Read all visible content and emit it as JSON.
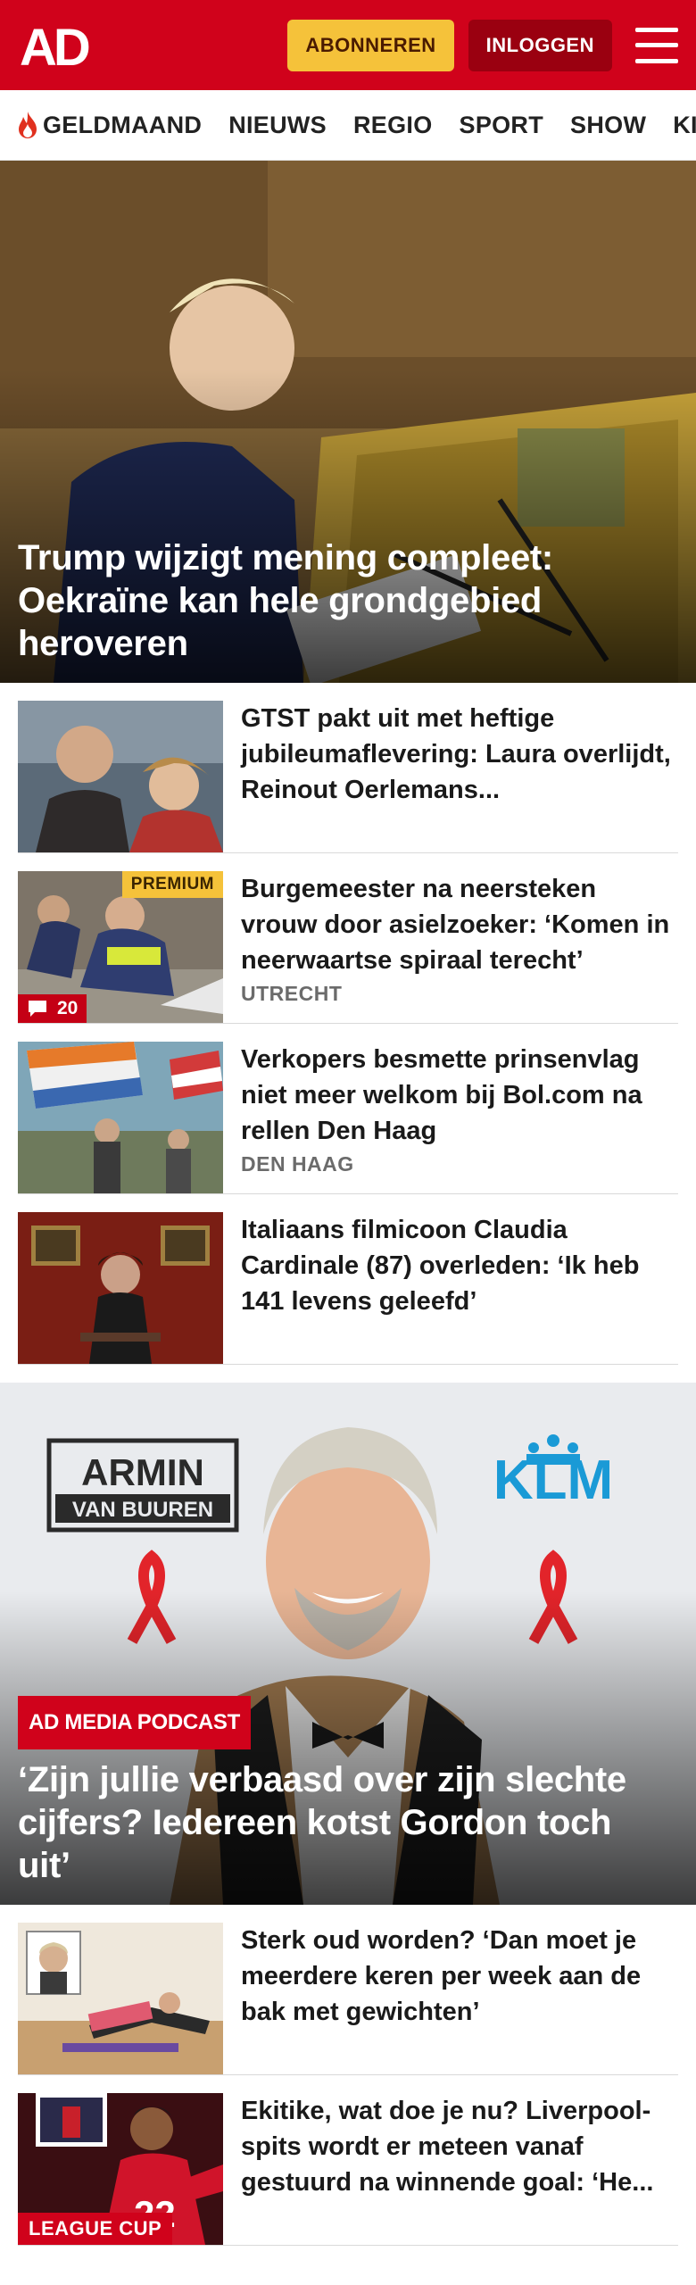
{
  "header": {
    "logo_text": "AD",
    "subscribe_label": "ABONNEREN",
    "login_label": "INLOGGEN",
    "menu_icon": "hamburger-menu-icon"
  },
  "nav": {
    "items": [
      {
        "label": "GELDMAAND",
        "icon": "flame-icon"
      },
      {
        "label": "NIEUWS"
      },
      {
        "label": "REGIO"
      },
      {
        "label": "SPORT"
      },
      {
        "label": "SHOW"
      },
      {
        "label": "KIJK"
      }
    ]
  },
  "hero": {
    "headline": "Trump wijzigt mening compleet: Oekraïne kan hele grondgebied heroveren"
  },
  "articles_a": [
    {
      "title": "GTST pakt uit met heftige jubileumaflevering: Laura overlijdt, Reinout Oerlemans...",
      "meta": ""
    },
    {
      "title": "Burgemeester na neersteken vrouw door asielzoeker: ‘Komen in neerwaartse spiraal terecht’",
      "meta": "UTRECHT",
      "premium": "PREMIUM",
      "comments": "20"
    },
    {
      "title": "Verkopers besmette prinsenvlag niet meer welkom bij Bol.com na rellen Den Haag",
      "meta": "DEN HAAG"
    },
    {
      "title": "Italiaans filmicoon Claudia Cardinale (87) overleden: ‘Ik heb 141 levens geleefd’",
      "meta": ""
    }
  ],
  "feature": {
    "tag": "AD MEDIA PODCAST",
    "headline": "‘Zijn jullie verbaasd over zijn slechte cijfers? Iedereen kotst Gordon toch uit’",
    "banner_left_line1": "ARMIN",
    "banner_left_line2": "VAN BUUREN",
    "banner_right": "KLM"
  },
  "articles_b": [
    {
      "title": "Sterk oud worden? ‘Dan moet je meerdere keren per week aan de bak met gewichten’"
    },
    {
      "title": "Ekitike, wat doe je nu? Liverpool-spits wordt er meteen vanaf gestuurd na winnende goal: ‘He...",
      "tag": "LEAGUE CUP"
    }
  ],
  "colors": {
    "brand_red": "#d0021b",
    "subscribe_yellow": "#f5c23a",
    "login_dark_red": "#9a0010"
  }
}
